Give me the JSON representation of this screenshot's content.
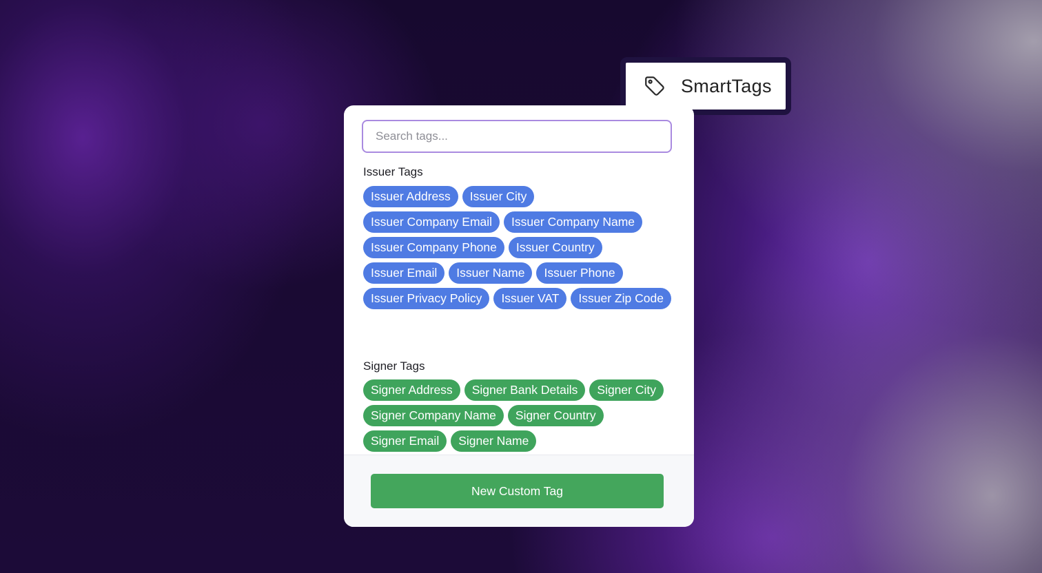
{
  "badge": {
    "icon": "tag-icon",
    "label": "SmartTags"
  },
  "search": {
    "placeholder": "Search tags...",
    "value": ""
  },
  "issuer_section": {
    "title": "Issuer Tags",
    "color": "#4f7be3",
    "tags": [
      "Issuer Address",
      "Issuer City",
      "Issuer Company Email",
      "Issuer Company Name",
      "Issuer Company Phone",
      "Issuer Country",
      "Issuer Email",
      "Issuer Name",
      "Issuer Phone",
      "Issuer Privacy Policy",
      "Issuer VAT",
      "Issuer Zip Code"
    ]
  },
  "signer_section": {
    "title": "Signer Tags",
    "color": "#3fa45c",
    "tags": [
      "Signer Address",
      "Signer Bank Details",
      "Signer City",
      "Signer Company Name",
      "Signer Country",
      "Signer Email",
      "Signer Name"
    ]
  },
  "footer": {
    "button_label": "New Custom Tag",
    "button_color": "#44a65c"
  }
}
